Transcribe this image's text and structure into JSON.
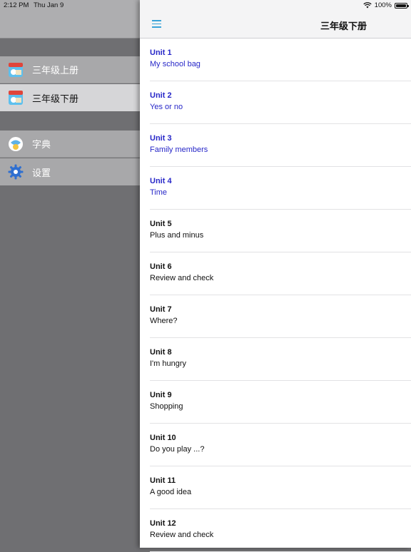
{
  "status_bar": {
    "time": "2:12 PM",
    "date": "Thu Jan 9",
    "battery": "100%"
  },
  "sidebar": {
    "items": [
      {
        "label": "三年级上册",
        "icon": "book-cover-icon"
      },
      {
        "label": "三年级下册",
        "icon": "book-cover-icon",
        "selected": true
      },
      {
        "label": "字典",
        "icon": "dictionary-icon"
      },
      {
        "label": "设置",
        "icon": "gear-icon"
      }
    ]
  },
  "nav": {
    "title": "三年级下册"
  },
  "units": [
    {
      "number": "Unit 1",
      "name": "My school bag",
      "active": true
    },
    {
      "number": "Unit 2",
      "name": "Yes or no",
      "active": true
    },
    {
      "number": "Unit 3",
      "name": "Family members",
      "active": true
    },
    {
      "number": "Unit 4",
      "name": "Time",
      "active": true
    },
    {
      "number": "Unit 5",
      "name": "Plus and minus",
      "active": false
    },
    {
      "number": "Unit 6",
      "name": "Review and check",
      "active": false
    },
    {
      "number": "Unit 7",
      "name": "Where?",
      "active": false
    },
    {
      "number": "Unit 8",
      "name": "I'm hungry",
      "active": false
    },
    {
      "number": "Unit 9",
      "name": "Shopping",
      "active": false
    },
    {
      "number": "Unit 10",
      "name": "Do you play ...?",
      "active": false
    },
    {
      "number": "Unit 11",
      "name": "A good idea",
      "active": false
    },
    {
      "number": "Unit 12",
      "name": "Review and check",
      "active": false
    }
  ],
  "colors": {
    "active_text": "#2727c8",
    "accent": "#3aa3d8"
  }
}
